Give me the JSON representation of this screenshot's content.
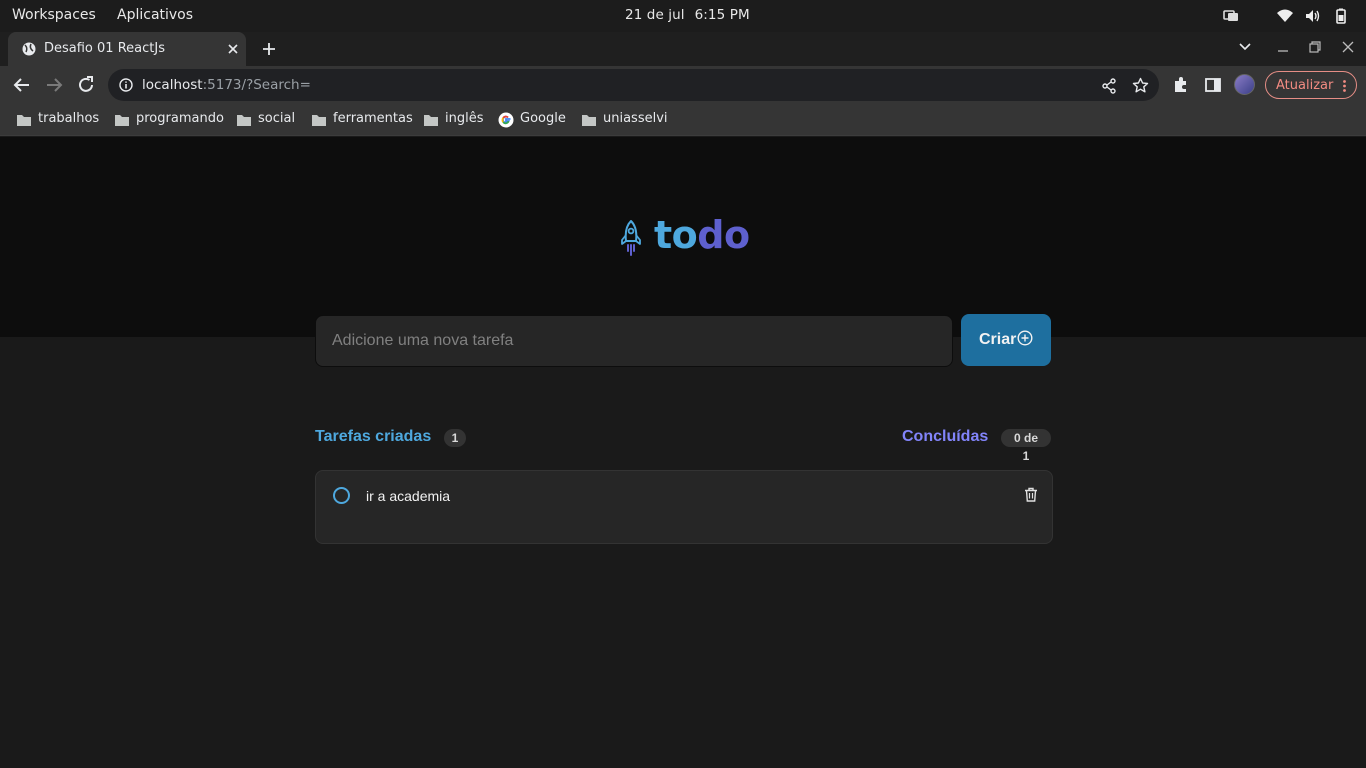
{
  "os": {
    "workspaces": "Workspaces",
    "apps": "Aplicativos",
    "date": "21 de jul",
    "time": "6:15 PM"
  },
  "browser": {
    "tab_title": "Desafio 01 ReactJs",
    "url_host": "localhost",
    "url_rest": ":5173/?Search=",
    "update_label": "Atualizar",
    "bookmarks": [
      {
        "label": "trabalhos",
        "icon": "folder-icon"
      },
      {
        "label": "programando",
        "icon": "folder-icon"
      },
      {
        "label": "social",
        "icon": "folder-icon"
      },
      {
        "label": "ferramentas",
        "icon": "folder-icon"
      },
      {
        "label": "inglês",
        "icon": "folder-icon"
      },
      {
        "label": "Google",
        "icon": "google-icon"
      },
      {
        "label": "uniasselvi",
        "icon": "folder-icon"
      }
    ]
  },
  "app": {
    "logo_to": "to",
    "logo_do": "do",
    "input_placeholder": "Adicione uma nova tarefa",
    "create_label": "Criar",
    "created_label": "Tarefas criadas",
    "created_count": "1",
    "done_label": "Concluídas",
    "done_count": "0 de 1",
    "tasks": [
      {
        "text": "ir a academia",
        "completed": false
      }
    ]
  },
  "colors": {
    "blue": "#4ea8de",
    "purple": "#8284fa",
    "button": "#1e6f9f",
    "header_bg": "#0d0d0d",
    "page_bg": "#1a1a1a"
  }
}
